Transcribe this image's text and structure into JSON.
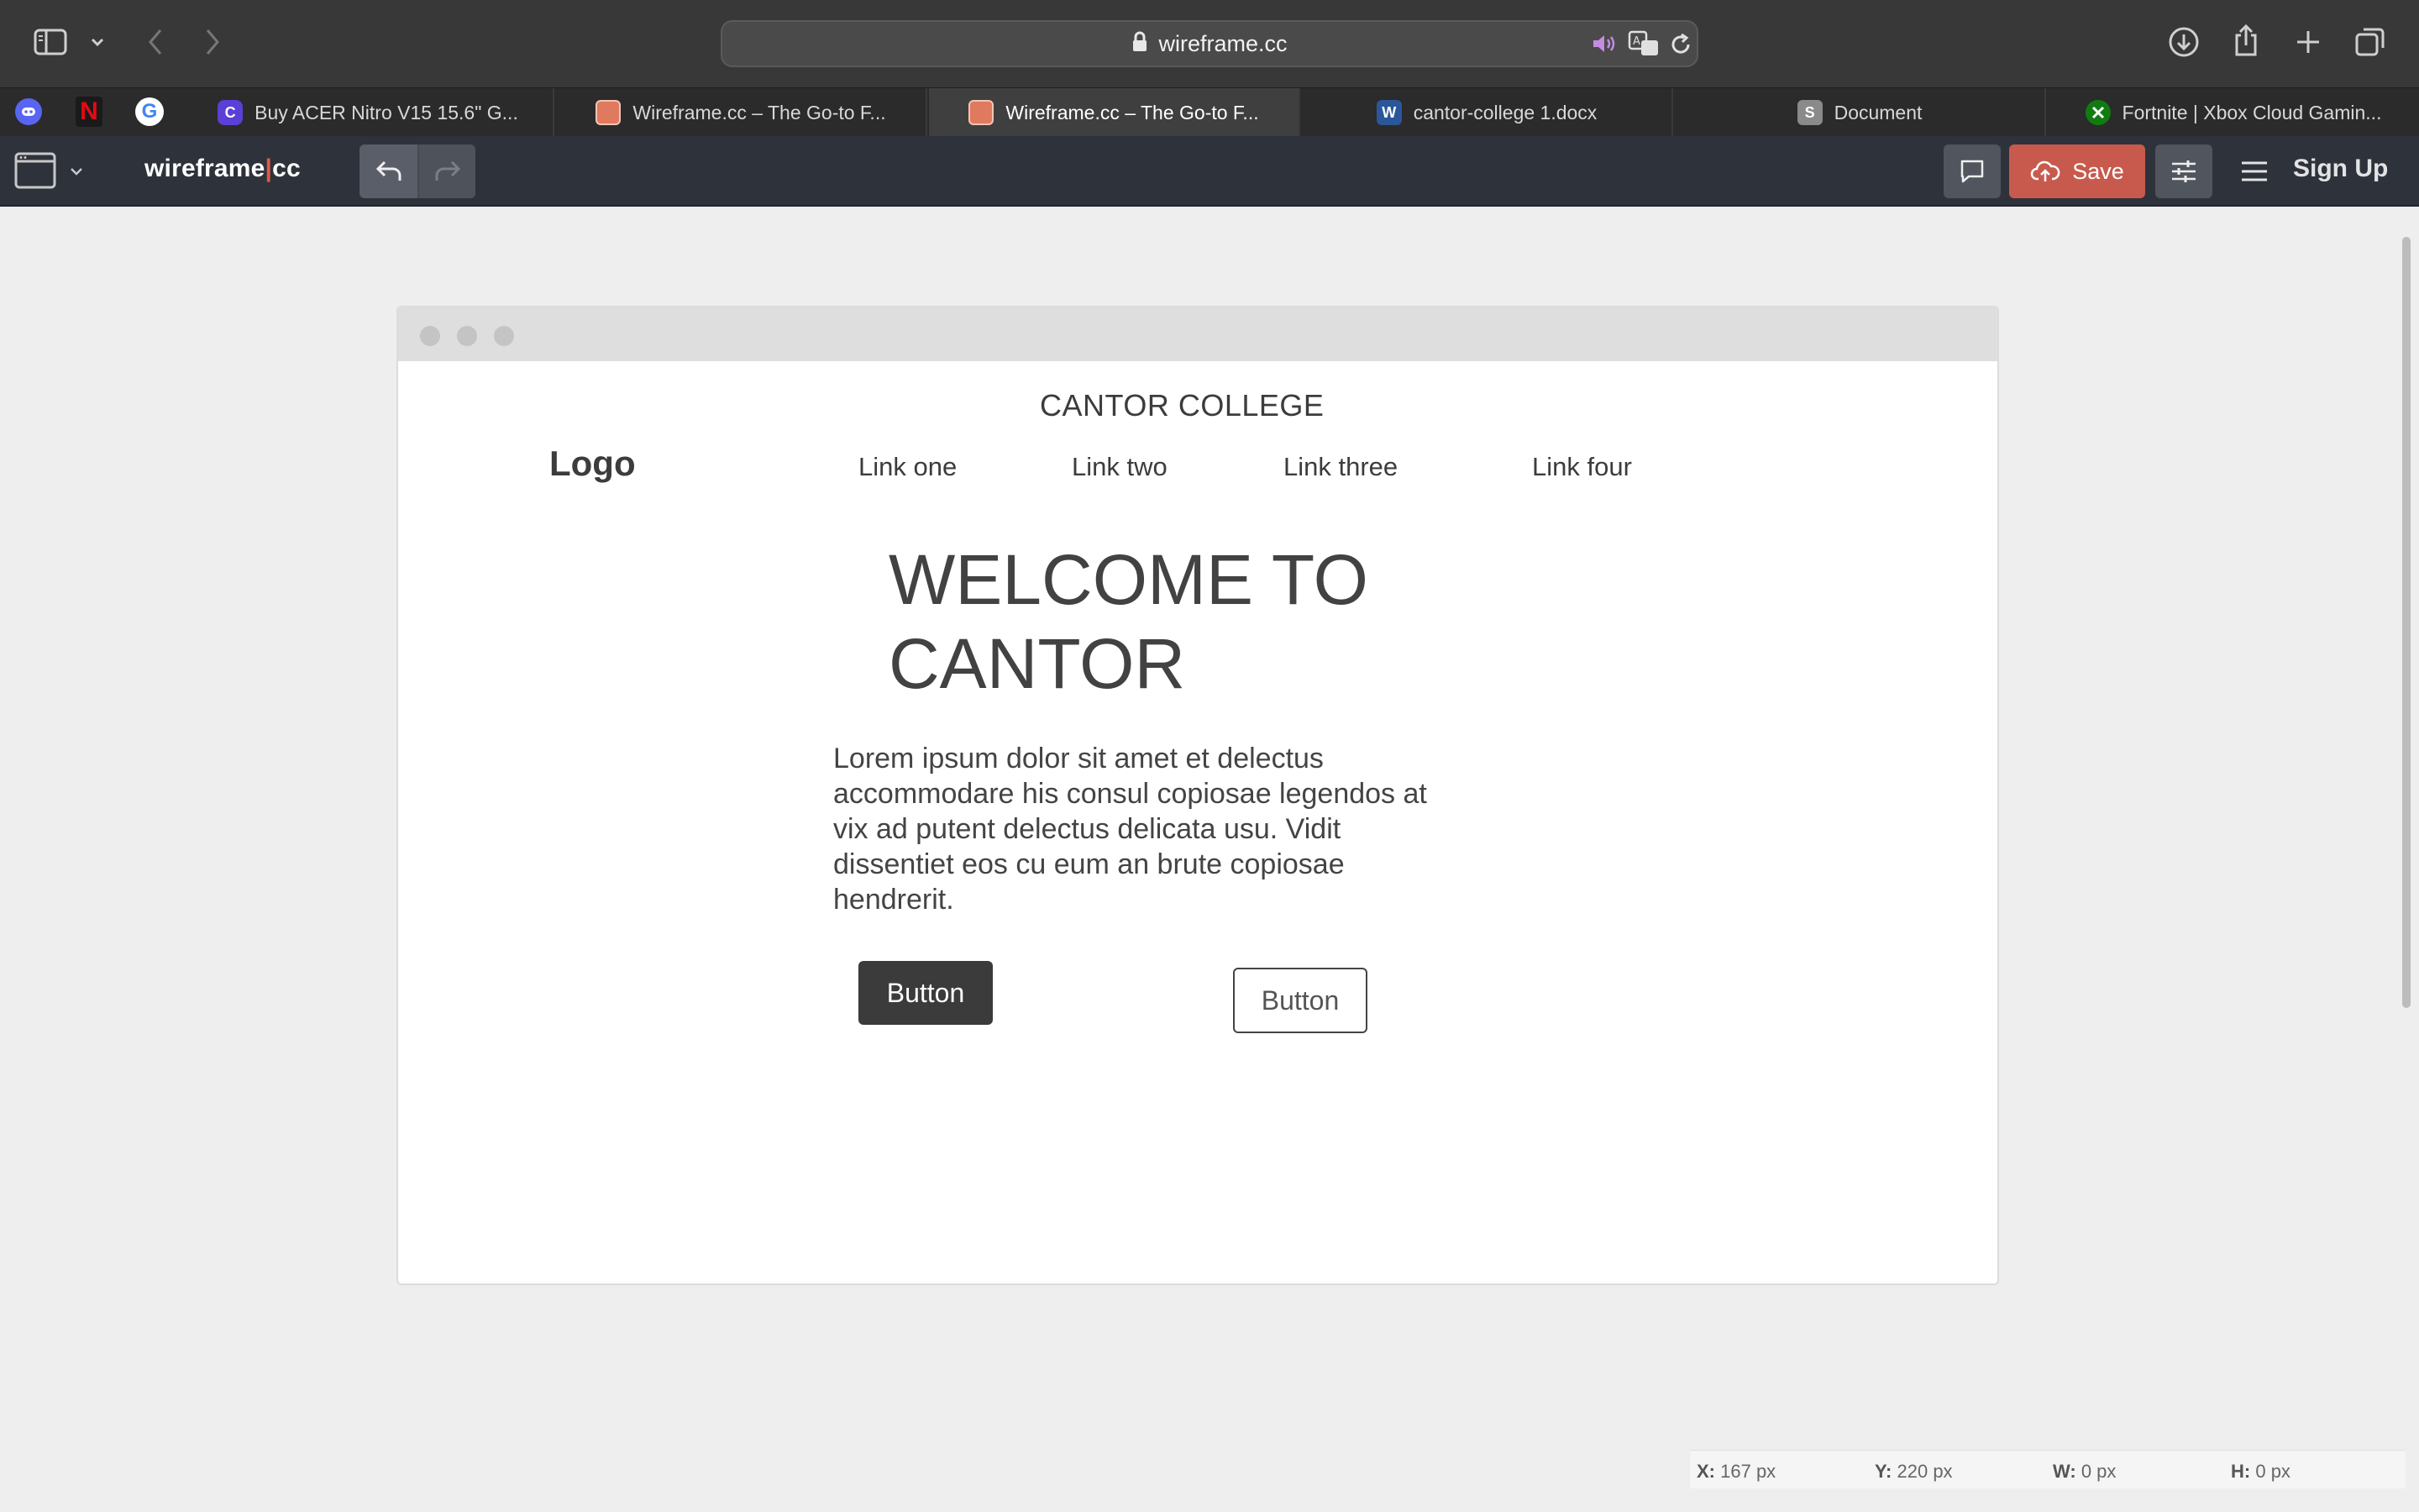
{
  "browser": {
    "url": "wireframe.cc",
    "tabs": [
      {
        "label": "Buy ACER Nitro V15 15.6\" G...",
        "favicon": "C"
      },
      {
        "label": "Wireframe.cc – The Go-to F..."
      },
      {
        "label": "Wireframe.cc – The Go-to F...",
        "active": true
      },
      {
        "label": "cantor-college 1.docx",
        "favicon": "W"
      },
      {
        "label": "Document",
        "favicon": "S"
      },
      {
        "label": "Fortnite | Xbox Cloud Gamin..."
      }
    ],
    "pinned_favicons": {
      "netflix": "N",
      "google": "G"
    }
  },
  "app": {
    "brand_left": "wireframe",
    "brand_sep": "|",
    "brand_right": "cc",
    "save_label": "Save",
    "signup_label": "Sign Up"
  },
  "wireframe": {
    "site_title": "CANTOR COLLEGE",
    "logo": "Logo",
    "links": [
      "Link one",
      "Link two",
      "Link three",
      "Link four"
    ],
    "heading_line1": "WELCOME TO",
    "heading_line2": "CANTOR",
    "paragraph": "Lorem ipsum dolor sit amet et delectus accommodare his consul copiosae legendos at vix ad putent delectus delicata usu. Vidit dissentiet eos cu eum an brute copiosae hendrerit.",
    "button_primary": "Button",
    "button_secondary": "Button"
  },
  "status": {
    "x_label": "X:",
    "x_value": "167 px",
    "y_label": "Y:",
    "y_value": "220 px",
    "w_label": "W:",
    "w_value": "0 px",
    "h_label": "H:",
    "h_value": "0 px"
  },
  "colors": {
    "save_button": "#c85a4d",
    "app_bar": "#2e323b",
    "brand_separator": "#e1584b"
  }
}
